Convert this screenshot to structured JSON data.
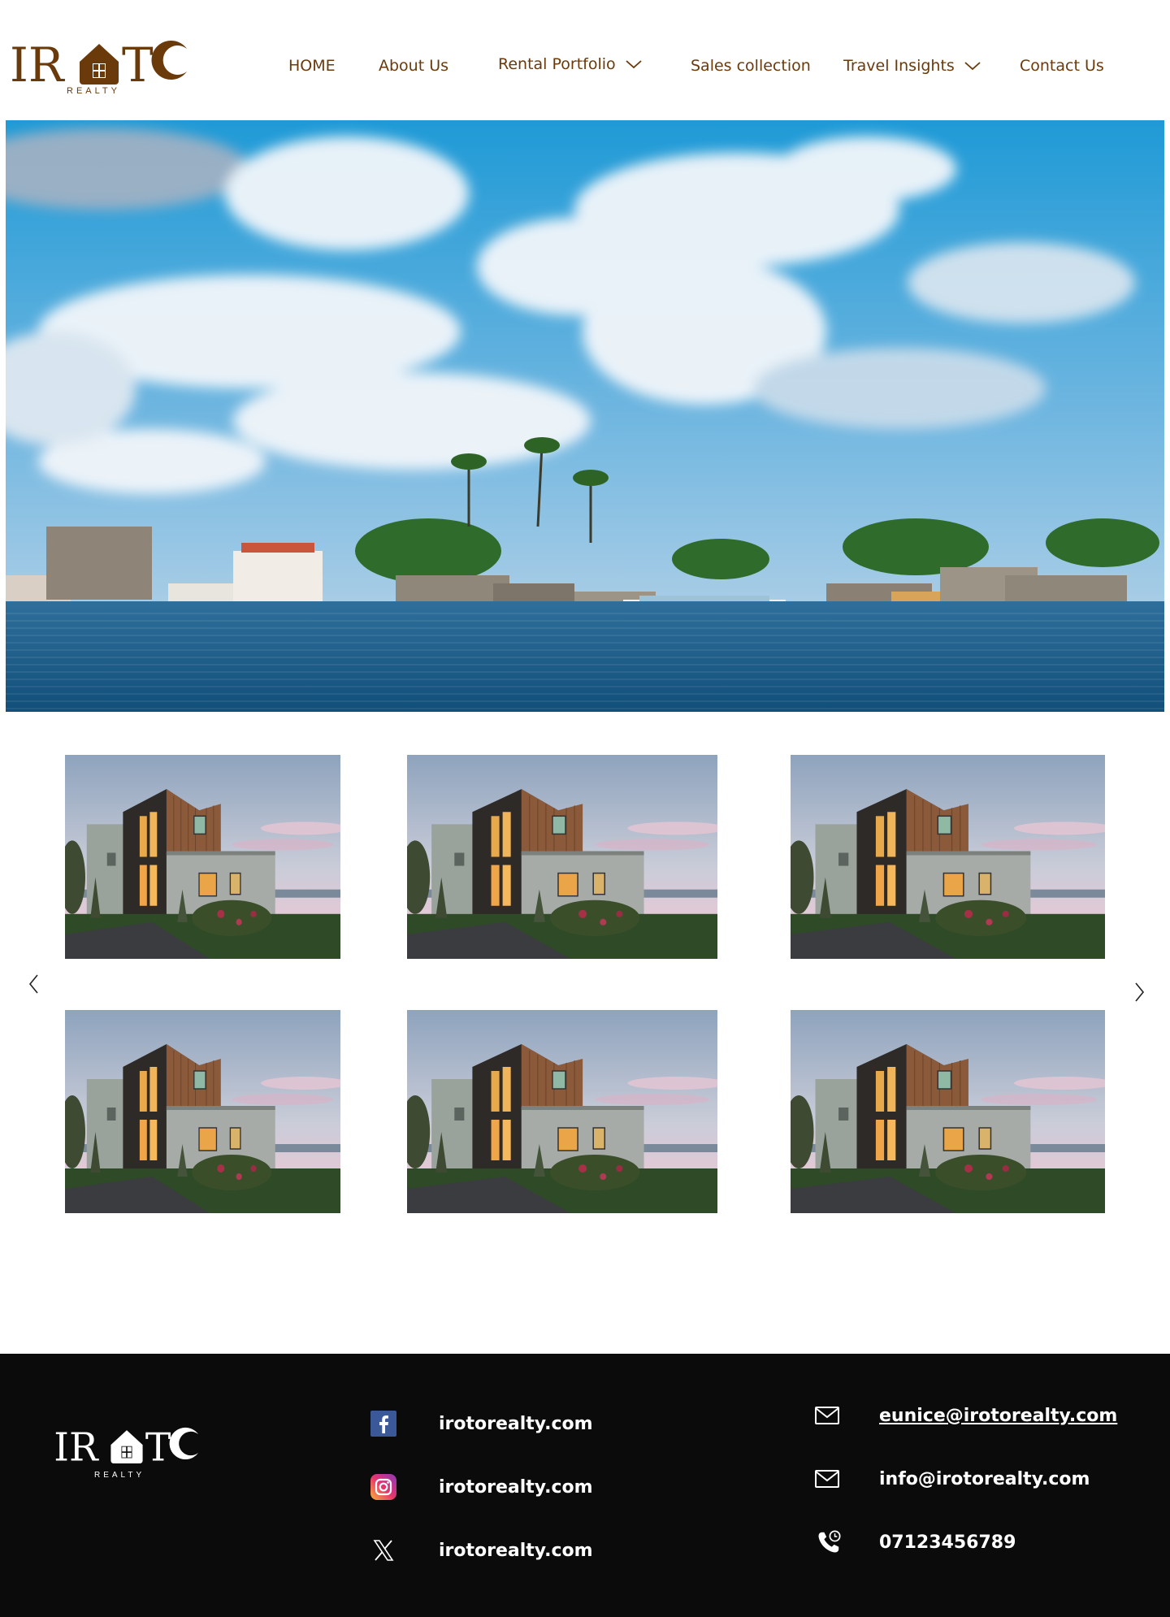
{
  "brand": {
    "name": "IROTO",
    "tagline": "REALTY",
    "color": "#6b3a0b"
  },
  "nav": {
    "items": [
      {
        "label": "HOME",
        "has_dropdown": false
      },
      {
        "label": "About Us",
        "has_dropdown": false
      },
      {
        "label": "Rental Portfolio",
        "has_dropdown": true
      },
      {
        "label": "Sales collection",
        "has_dropdown": false
      },
      {
        "label": "Travel Insights",
        "has_dropdown": true
      },
      {
        "label": "Contact Us",
        "has_dropdown": false
      }
    ]
  },
  "hero": {
    "image": "coastal-town-waterfront-photo"
  },
  "gallery": {
    "image": "modern-house-photo",
    "count": 6,
    "prev_icon": "chevron-left-icon",
    "next_icon": "chevron-right-icon"
  },
  "footer": {
    "background": "#0b0b0b",
    "social": [
      {
        "icon": "facebook-icon",
        "label": "irotorealty.com"
      },
      {
        "icon": "instagram-icon",
        "label": "irotorealty.com"
      },
      {
        "icon": "x-icon",
        "label": "irotorealty.com"
      }
    ],
    "contacts": [
      {
        "icon": "mail-icon",
        "label": "eunice@irotorealty.com"
      },
      {
        "icon": "mail-icon",
        "label": "info@irotorealty.com"
      },
      {
        "icon": "phone-icon",
        "label": "07123456789"
      }
    ]
  }
}
